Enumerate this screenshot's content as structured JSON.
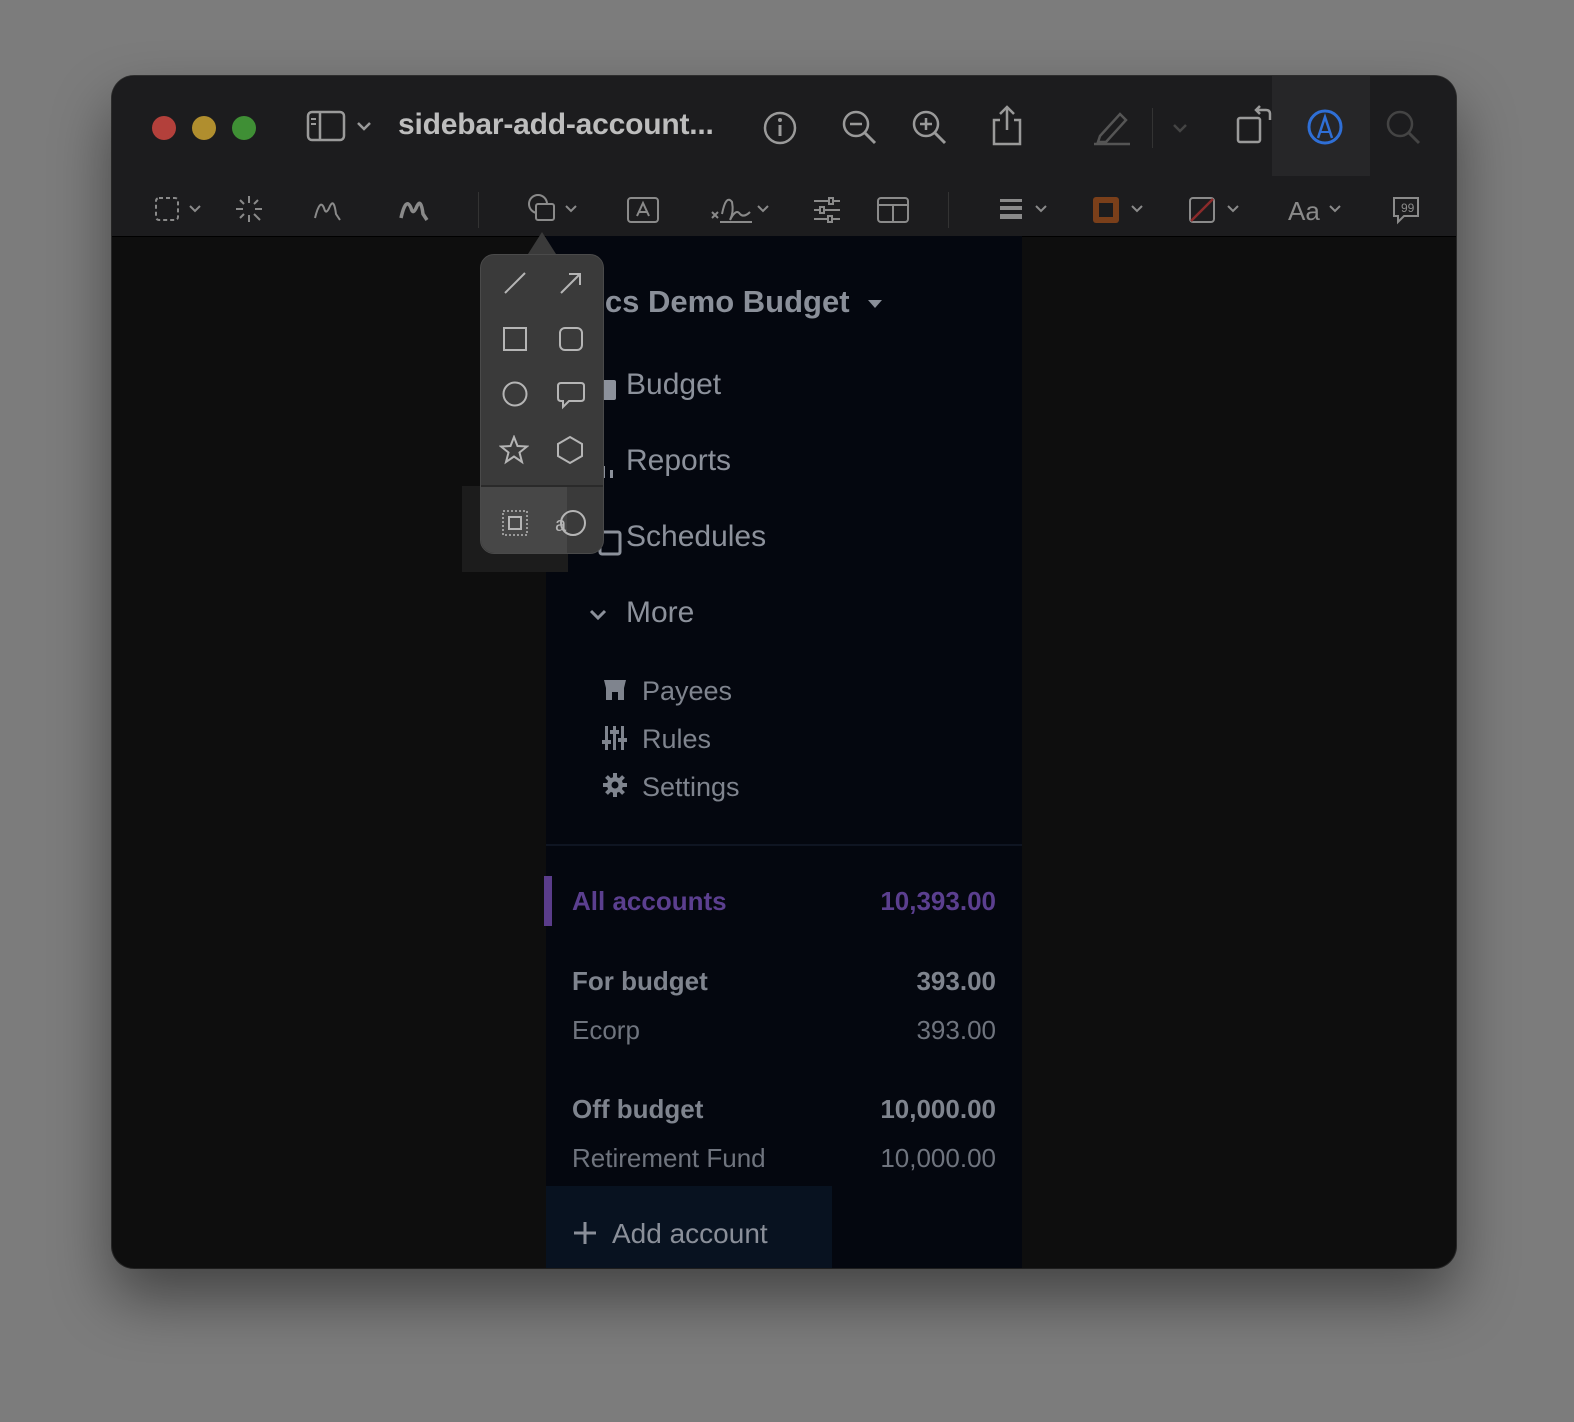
{
  "window": {
    "title": "sidebar-add-account...",
    "accent_color": "#2f6fd6"
  },
  "titlebar_icons": [
    "sidebar-toggle-icon",
    "chevron-down-icon",
    "info-icon",
    "zoom-out-icon",
    "zoom-in-icon",
    "share-icon",
    "highlight-pen-icon",
    "chevron-down-icon",
    "rotate-icon",
    "markup-icon",
    "search-icon"
  ],
  "toolbar_icons": [
    "rectangular-selection-icon",
    "instant-alpha-icon",
    "sketch-icon",
    "draw-icon",
    "shapes-icon",
    "text-box-icon",
    "signature-icon",
    "adjust-color-icon",
    "page-layout-icon",
    "line-style-icon",
    "border-color-icon",
    "fill-color-icon",
    "text-style-icon",
    "note-icon"
  ],
  "toolbar": {
    "text_style_label": "Aa"
  },
  "shapes_popover": {
    "items": [
      "line",
      "arrow",
      "rectangle",
      "rounded-rectangle",
      "oval",
      "speech-bubble",
      "star",
      "polygon",
      "mask",
      "loupe"
    ]
  },
  "sidebar": {
    "budget_name": "ocs Demo Budget",
    "nav": {
      "budget": "Budget",
      "reports": "Reports",
      "schedules": "Schedules",
      "more": "More"
    },
    "more_items": {
      "payees": "Payees",
      "rules": "Rules",
      "settings": "Settings"
    },
    "accounts": {
      "all": {
        "name": "All accounts",
        "value": "10,393.00",
        "color": "#5b3f8f"
      },
      "for_budget": {
        "name": "For budget",
        "value": "393.00"
      },
      "ecorp": {
        "name": "Ecorp",
        "value": "393.00"
      },
      "off_budget": {
        "name": "Off budget",
        "value": "10,000.00"
      },
      "retirement": {
        "name": "Retirement Fund",
        "value": "10,000.00"
      }
    },
    "add_account": "Add account"
  }
}
